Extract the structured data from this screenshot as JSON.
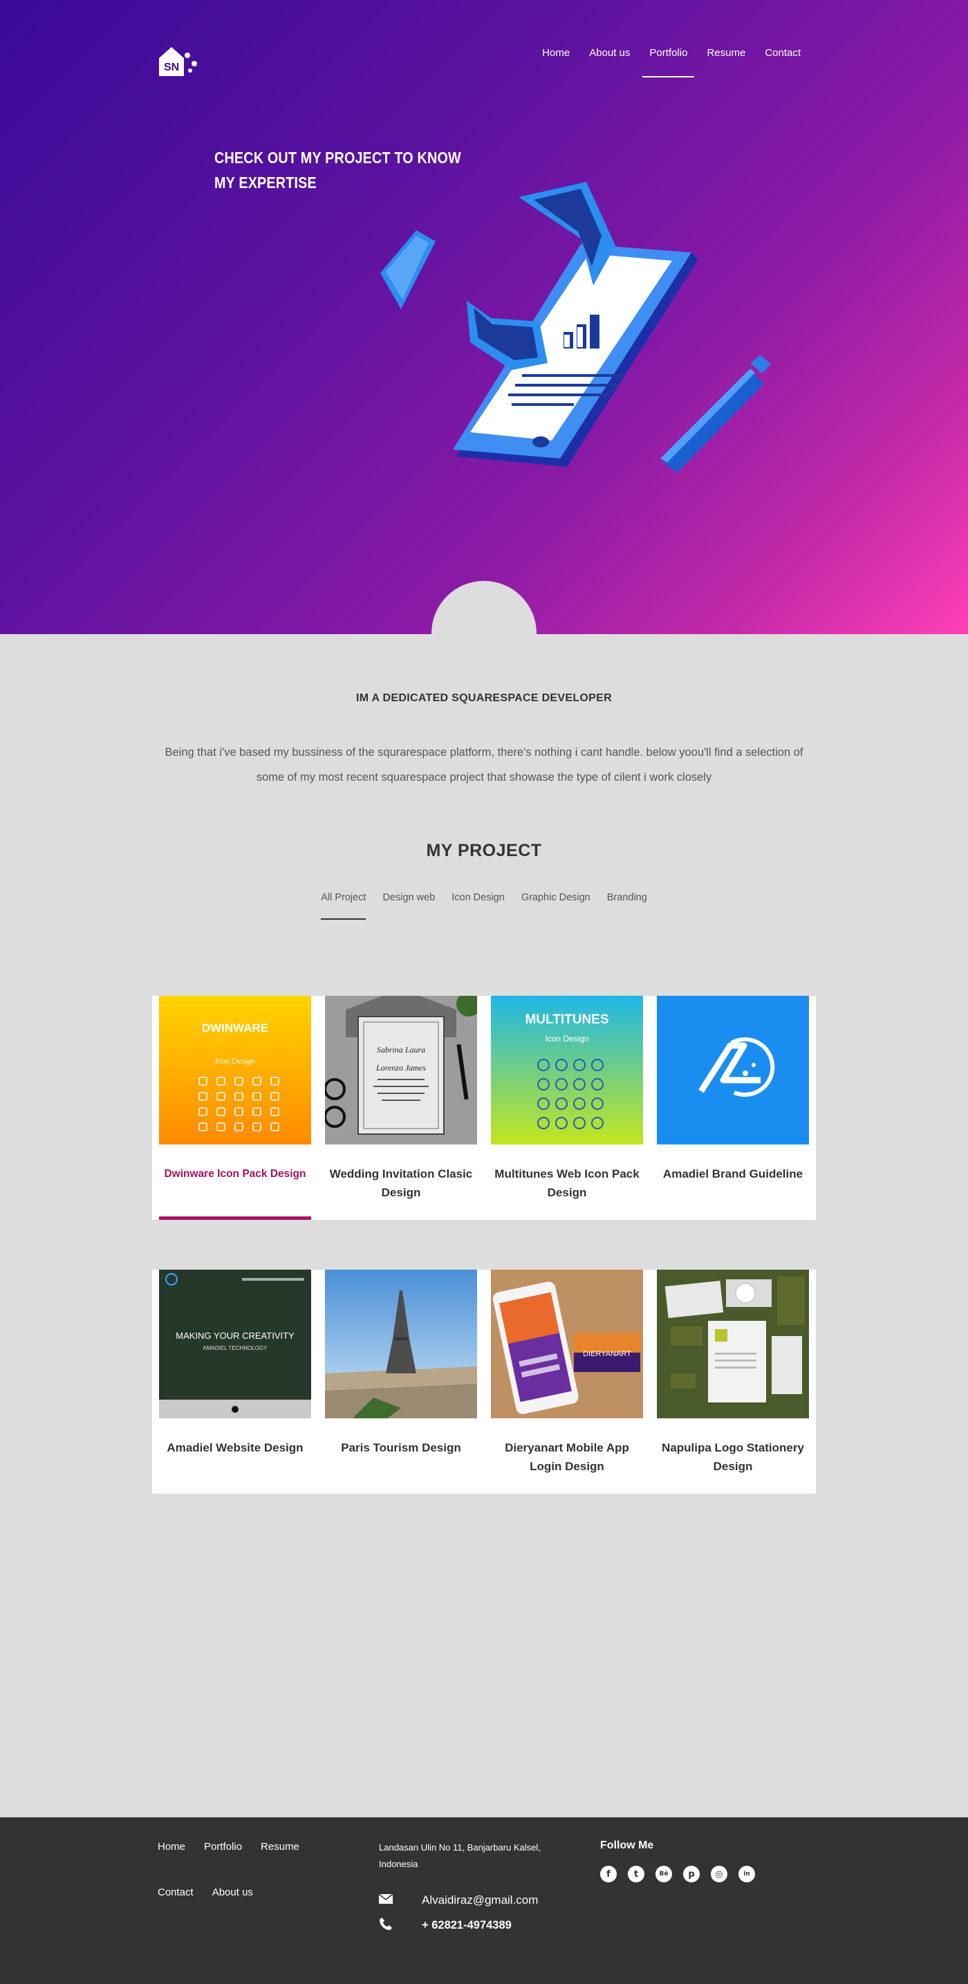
{
  "brand": {
    "logo_text": "SN"
  },
  "nav": [
    {
      "label": "Home",
      "active": false
    },
    {
      "label": "About us",
      "active": false
    },
    {
      "label": "Portfolio",
      "active": true
    },
    {
      "label": "Resume",
      "active": false
    },
    {
      "label": "Contact",
      "active": false
    }
  ],
  "hero": {
    "title": "CHECK OUT MY PROJECT TO KNOW MY EXPERTISE"
  },
  "intro": {
    "title": "IM A DEDICATED SQUARESPACE DEVELOPER",
    "text": "Being that i've based my bussiness of the squrarespace platform, there's nothing i cant handle. below yoou'll find a selection of some of my most recent squarespace project that showase the type of cilent i work closely"
  },
  "projects_section": {
    "title": "MY PROJECT",
    "filters": [
      "All Project",
      "Design web",
      "Icon Design",
      "Graphic Design",
      "Branding"
    ],
    "active_filter": "All Project"
  },
  "projects": [
    {
      "title": "Dwinware Icon Pack Design",
      "thumb": "dwinware",
      "thumb_heading": "DWINWARE",
      "thumb_sub": "Icon Design",
      "selected": true
    },
    {
      "title": "Wedding Invitation Clasic Design",
      "thumb": "wedding",
      "thumb_heading": "Sabrina Laura",
      "thumb_sub": "Lorenzo James",
      "selected": false
    },
    {
      "title": "Multitunes Web Icon Pack Design",
      "thumb": "multitunes",
      "thumb_heading": "MULTITUNES",
      "thumb_sub": "Icon Design",
      "selected": false
    },
    {
      "title": "Amadiel Brand Guideline",
      "thumb": "amadiel-brand",
      "selected": false
    },
    {
      "title": "Amadiel Website Design",
      "thumb": "amadiel-web",
      "thumb_heading": "MAKING YOUR CREATIVITY",
      "thumb_sub": "AMADIEL TECHNOLOGY",
      "selected": false
    },
    {
      "title": "Paris Tourism Design",
      "thumb": "paris",
      "selected": false
    },
    {
      "title": "Dieryanart Mobile App Login Design",
      "thumb": "dieryanart",
      "thumb_heading": "DIERYANART",
      "selected": false
    },
    {
      "title": "Napulipa Logo Stationery Design",
      "thumb": "napulipa",
      "selected": false
    }
  ],
  "footer": {
    "links": [
      "Home",
      "Portfolio",
      "Resume",
      "Contact",
      "About us"
    ],
    "address": "Landasan Ulin No 11, Banjarbaru Kalsel, Indonesia",
    "email": "Alvaidiraz@gmail.com",
    "phone": "+ 62821-4974389",
    "follow_title": "Follow Me",
    "social": [
      {
        "icon": "facebook-icon",
        "glyph": "f"
      },
      {
        "icon": "twitter-icon",
        "glyph": "t"
      },
      {
        "icon": "behance-icon",
        "glyph": "Bē"
      },
      {
        "icon": "pinterest-icon",
        "glyph": "p"
      },
      {
        "icon": "instagram-icon",
        "glyph": "◎"
      },
      {
        "icon": "linkedin-icon",
        "glyph": "in"
      }
    ]
  },
  "colors": {
    "accent": "#a51160",
    "footer_bg": "#333333",
    "page_bg": "#dddddd",
    "hero_start": "#3b0a98",
    "hero_end": "#ff3fb8"
  }
}
